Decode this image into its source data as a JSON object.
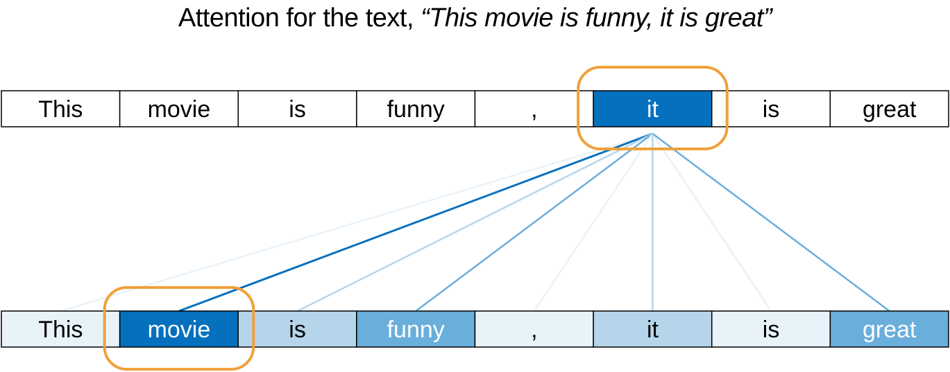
{
  "title": {
    "prefix": "Attention for the text, ",
    "quote": "“This movie is funny, it is great”"
  },
  "query_index": 5,
  "tokens": [
    "This",
    "movie",
    "is",
    "funny",
    ",",
    "it",
    "is",
    "great"
  ],
  "attention_levels": [
    1,
    4,
    2,
    3,
    1,
    2,
    1,
    3
  ],
  "highlighted_tokens": {
    "query": 5,
    "key": 1
  },
  "colors": {
    "level_1": "#e8f2f9",
    "level_2": "#b6d5ea",
    "level_3": "#6aaedb",
    "level_4": "#0570be",
    "border": "#000000",
    "highlight_ring": "#f0a03a",
    "dark_text": "#000000",
    "light_text": "#ffffff"
  }
}
